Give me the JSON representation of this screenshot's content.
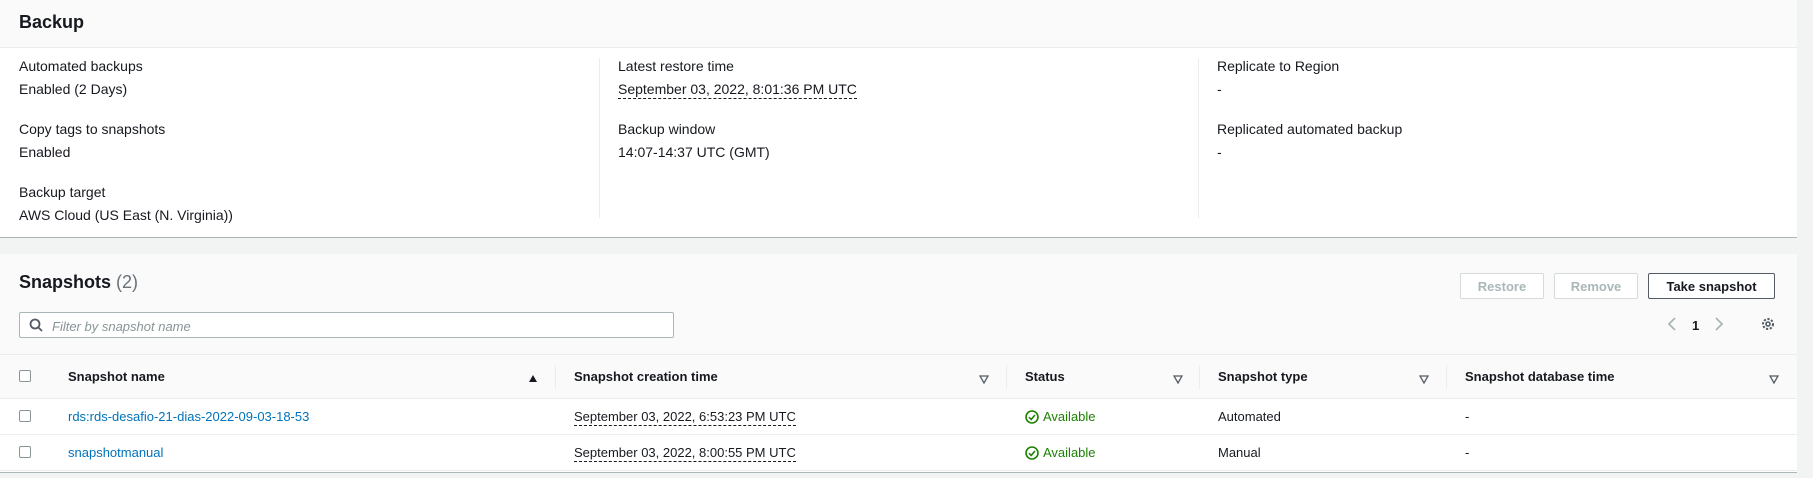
{
  "backup": {
    "title": "Backup",
    "col1": [
      {
        "label": "Automated backups",
        "value": "Enabled (2 Days)"
      },
      {
        "label": "Copy tags to snapshots",
        "value": "Enabled"
      },
      {
        "label": "Backup target",
        "value": "AWS Cloud (US East (N. Virginia))"
      }
    ],
    "col2": [
      {
        "label": "Latest restore time",
        "value": "September 03, 2022, 8:01:36 PM UTC"
      },
      {
        "label": "Backup window",
        "value": "14:07-14:37 UTC (GMT)"
      }
    ],
    "col3": [
      {
        "label": "Replicate to Region",
        "value": "-"
      },
      {
        "label": "Replicated automated backup",
        "value": "-"
      }
    ]
  },
  "snapshots": {
    "title": "Snapshots",
    "count": "(2)",
    "buttons": {
      "restore": "Restore",
      "remove": "Remove",
      "take": "Take snapshot"
    },
    "search_placeholder": "Filter by snapshot name",
    "page": "1",
    "columns": [
      "Snapshot name",
      "Snapshot creation time",
      "Status",
      "Snapshot type",
      "Snapshot database time"
    ],
    "rows": [
      {
        "name": "rds:rds-desafio-21-dias-2022-09-03-18-53",
        "created": "September 03, 2022, 6:53:23 PM UTC",
        "status": "Available",
        "type": "Automated",
        "dbtime": "-"
      },
      {
        "name": "snapshotmanual",
        "created": "September 03, 2022, 8:00:55 PM UTC",
        "status": "Available",
        "type": "Manual",
        "dbtime": "-"
      }
    ]
  },
  "colors": {
    "link": "#0073bb",
    "success": "#1d8102"
  }
}
